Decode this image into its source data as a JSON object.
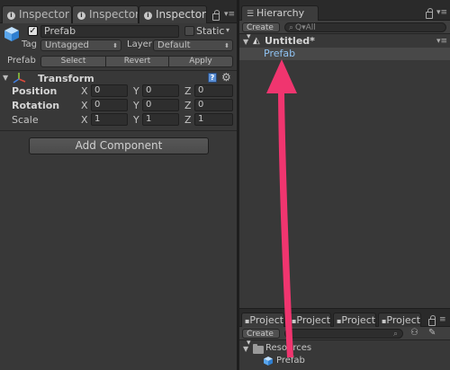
{
  "inspector": {
    "tabs": [
      {
        "label": "Inspector",
        "active": false
      },
      {
        "label": "Inspector",
        "active": false
      },
      {
        "label": "Inspector",
        "active": true
      }
    ],
    "object": {
      "name": "Prefab",
      "active": true,
      "static_label": "Static",
      "static": false,
      "tag_label": "Tag",
      "tag_value": "Untagged",
      "layer_label": "Layer",
      "layer_value": "Default"
    },
    "prefab": {
      "label": "Prefab",
      "select": "Select",
      "revert": "Revert",
      "apply": "Apply"
    },
    "transform": {
      "title": "Transform",
      "rows": [
        {
          "label": "Position",
          "x": "0",
          "y": "0",
          "z": "0"
        },
        {
          "label": "Rotation",
          "x": "0",
          "y": "0",
          "z": "0"
        },
        {
          "label": "Scale",
          "x": "1",
          "y": "1",
          "z": "1"
        }
      ],
      "axes": {
        "x": "X",
        "y": "Y",
        "z": "Z"
      }
    },
    "add_component": "Add Component"
  },
  "hierarchy": {
    "tab": "Hierarchy",
    "create": "Create",
    "create_arrow": "▾",
    "search_placeholder": "Q▾All",
    "scene": "Untitled*",
    "items": [
      "Prefab"
    ]
  },
  "project": {
    "tabs": [
      {
        "label": "Project",
        "active": true
      },
      {
        "label": "Project",
        "active": false
      },
      {
        "label": "Project",
        "active": false
      },
      {
        "label": "Project",
        "active": false
      }
    ],
    "create": "Create",
    "tree": [
      {
        "label": "Resources",
        "type": "folder"
      },
      {
        "label": "Prefab",
        "type": "prefab"
      }
    ]
  },
  "colors": {
    "selection_row": "#484848",
    "arrow": "#f0356f",
    "prefab_blue": "#8fc2f2"
  },
  "icons": {
    "info": "info-icon",
    "lock": "lock-icon",
    "menu": "panel-menu-icon",
    "cube": "gameobject-cube-icon",
    "gear": "gear-icon",
    "help": "help-book-icon",
    "folder": "folder-icon",
    "search": "search-icon",
    "arrow": "annotation-arrow"
  }
}
